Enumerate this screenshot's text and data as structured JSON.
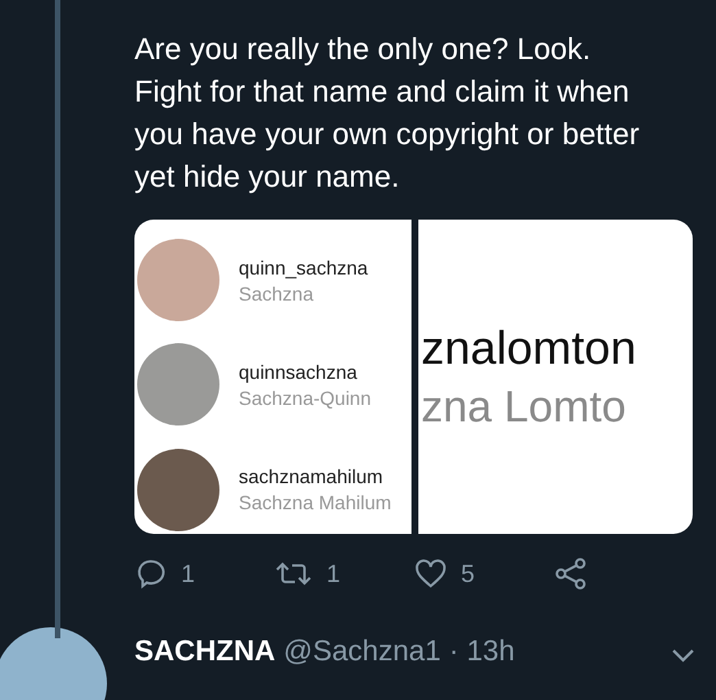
{
  "tweet": {
    "text": "Are you really the only one? Look. Fight for that name and claim it when you have your own copyright or better yet hide your name.",
    "media": {
      "accounts": [
        {
          "username": "quinn_sachzna",
          "name": "Sachzna",
          "color": "#c9a89a"
        },
        {
          "username": "quinnsachzna",
          "name": "Sachzna-Quinn",
          "color": "#9a9a98"
        },
        {
          "username": "sachznamahilum",
          "name": "Sachzna Mahilum",
          "color": "#6b5a4e"
        }
      ],
      "zoomed": {
        "username": "znalomton",
        "name": "zna Lomto"
      }
    },
    "actions": [
      {
        "kind": "reply",
        "count": "1"
      },
      {
        "kind": "retweet",
        "count": "1"
      },
      {
        "kind": "like",
        "count": "5"
      },
      {
        "kind": "share"
      }
    ]
  },
  "reply": {
    "display_name": "SACHZNA",
    "handle": "@Sachzna1",
    "time": "· 13h"
  }
}
